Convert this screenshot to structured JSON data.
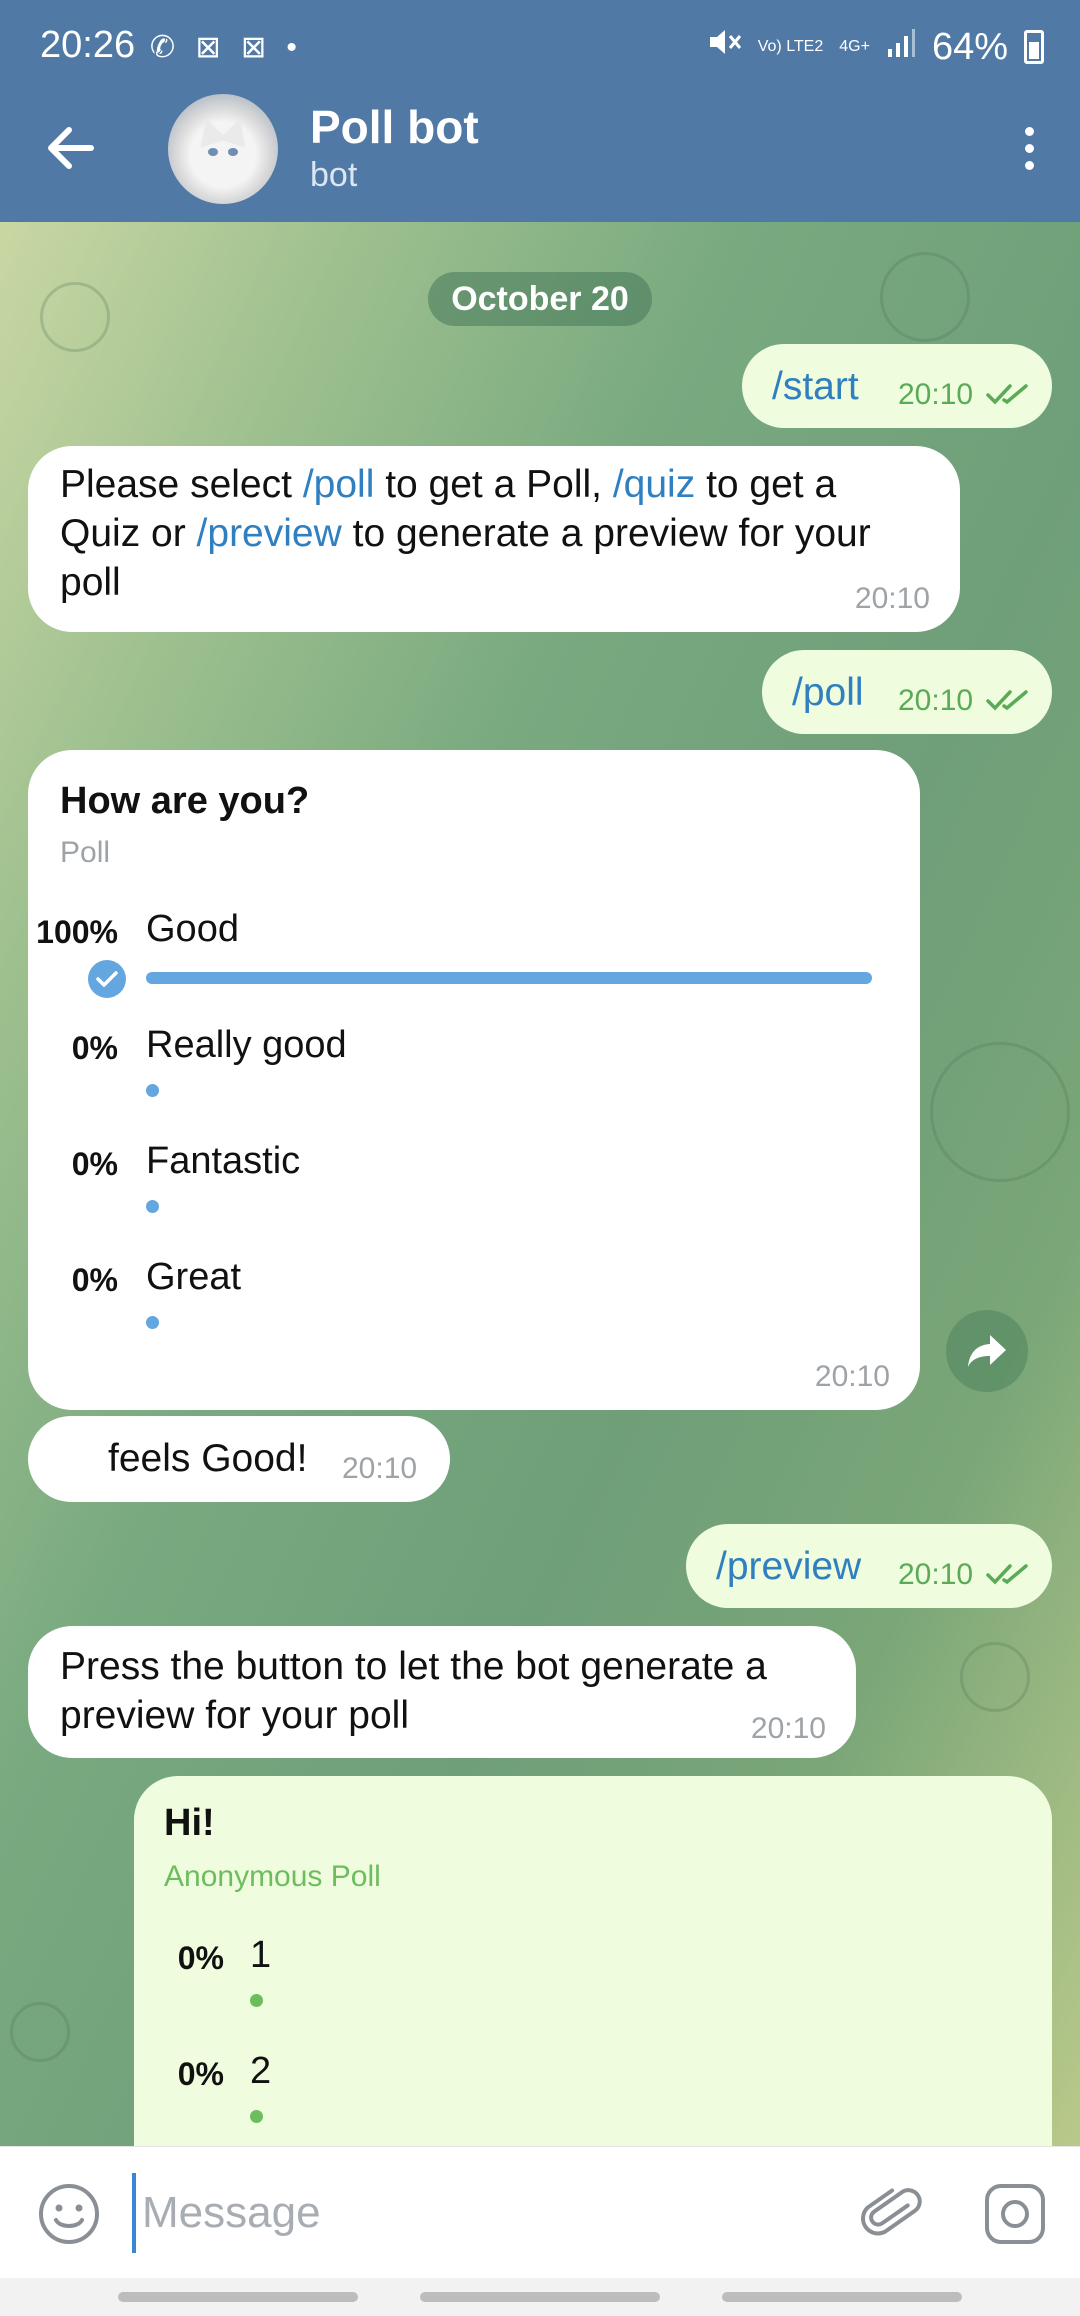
{
  "status_bar": {
    "time": "20:26",
    "left_icons": "✆ ⊠ ⊠ •",
    "volte": "Vo) LTE2",
    "network": "4G+",
    "battery": "64%"
  },
  "header": {
    "title": "Poll bot",
    "subtitle": "bot"
  },
  "date_divider": "October 20",
  "messages": {
    "start": {
      "text": "/start",
      "time": "20:10"
    },
    "welcome": {
      "p1": "Please select ",
      "cmd_poll": "/poll",
      "p2": " to get a Poll, ",
      "cmd_quiz": "/quiz",
      "p3": " to get a",
      "p4": "Quiz or ",
      "cmd_preview": "/preview",
      "p5": " to generate a preview for your",
      "p6": "poll",
      "time": "20:10"
    },
    "poll_cmd": {
      "text": "/poll",
      "time": "20:10"
    },
    "poll": {
      "question": "How are you?",
      "type": "Poll",
      "options": [
        {
          "pct": "100%",
          "label": "Good",
          "fraction": 1.0,
          "chosen": true
        },
        {
          "pct": "0%",
          "label": "Really good",
          "fraction": 0.0,
          "chosen": false
        },
        {
          "pct": "0%",
          "label": "Fantastic",
          "fraction": 0.0,
          "chosen": false
        },
        {
          "pct": "0%",
          "label": "Great",
          "fraction": 0.0,
          "chosen": false
        }
      ],
      "time": "20:10"
    },
    "feels": {
      "text": "feels Good!",
      "time": "20:10"
    },
    "preview_cmd": {
      "text": "/preview",
      "time": "20:10"
    },
    "press": {
      "line1": "Press the button to let the bot generate a",
      "line2": "preview for your poll",
      "time": "20:10"
    },
    "preview_poll": {
      "question": "Hi!",
      "type": "Anonymous Poll",
      "options": [
        {
          "pct": "0%",
          "label": "1",
          "fraction": 0.0
        },
        {
          "pct": "0%",
          "label": "2",
          "fraction": 0.0
        }
      ]
    }
  },
  "input": {
    "placeholder": "Message"
  },
  "colors": {
    "header": "#5179a6",
    "link": "#2f7fc1",
    "outgoing_bubble": "#effdde",
    "poll_bar": "#64a6e0",
    "outgoing_time": "#5aaa58"
  }
}
